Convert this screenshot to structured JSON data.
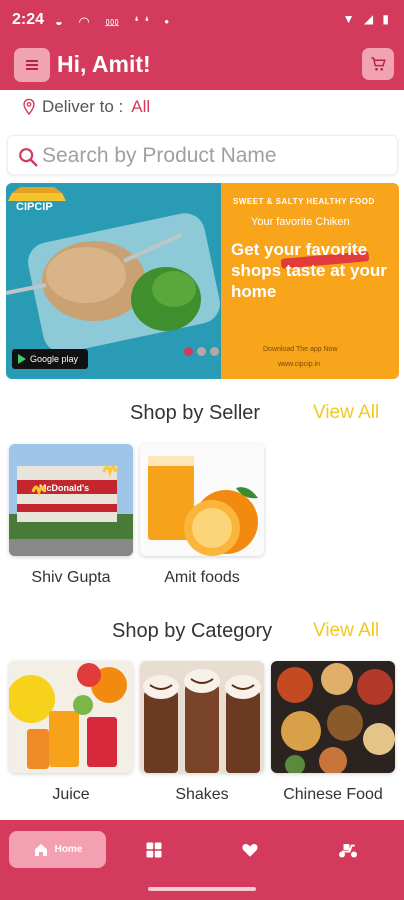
{
  "status_bar": {
    "time": "2:24",
    "right_text": "VoLTE LTE"
  },
  "app_bar": {
    "greeting": "Hi, Amit!",
    "menu_icon": "hamburger-icon",
    "cart_icon": "cart-icon",
    "color": "#d33a5c"
  },
  "deliver": {
    "label": "Deliver to :",
    "value": "All"
  },
  "search": {
    "placeholder": "Search by Product Name"
  },
  "banner": {
    "brand": "CIPCIP",
    "google_play": "Google play",
    "tagline": "SWEET & SALTY HEALTHY FOOD",
    "subtitle": "Your favorite Chiken",
    "headline": "Get your favorite shops taste at your home",
    "download": "Download The app Now",
    "website": "www.cipcip.in",
    "active_slide": 1,
    "slides": 3
  },
  "sellers": {
    "title": "Shop by Seller",
    "view_all": "View All",
    "items": [
      {
        "label": "Shiv Gupta"
      },
      {
        "label": "Amit foods"
      }
    ]
  },
  "categories": {
    "title": "Shop by Category",
    "view_all": "View All",
    "items": [
      {
        "label": "Juice"
      },
      {
        "label": "Shakes"
      },
      {
        "label": "Chinese Food"
      }
    ]
  },
  "bottom_nav": {
    "home": "Home",
    "items": [
      "home-icon",
      "grid-icon",
      "heart-icon",
      "scooter-icon"
    ]
  }
}
